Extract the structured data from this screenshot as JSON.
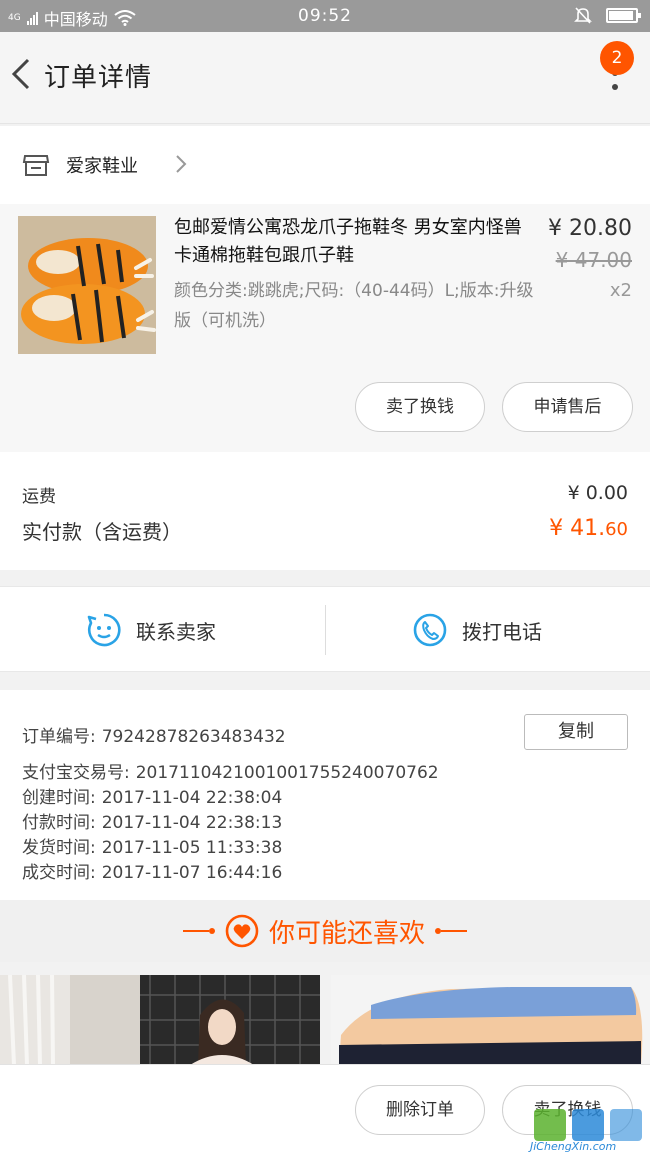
{
  "status_bar": {
    "network": "4G",
    "carrier": "中国移动",
    "time": "09:52"
  },
  "header": {
    "title": "订单详情",
    "badge_count": "2"
  },
  "shop": {
    "name": "爱家鞋业"
  },
  "product": {
    "title": "包邮爱情公寓恐龙爪子拖鞋冬 男女室内怪兽卡通棉拖鞋包跟爪子鞋",
    "spec": "颜色分类:跳跳虎;尺码:（40-44码）L;版本:升级版（可机洗）",
    "price": "¥ 20.80",
    "original_price": "¥ 47.00",
    "quantity": "x2",
    "sell_label": "卖了换钱",
    "after_sale_label": "申请售后"
  },
  "fees": {
    "shipping_label": "运费",
    "shipping_value": "¥ 0.00",
    "paid_label": "实付款（含运费）",
    "paid_value_main": "¥ 41.",
    "paid_value_cents": "60"
  },
  "contact": {
    "chat_label": "联系卖家",
    "call_label": "拨打电话"
  },
  "order_info": {
    "copy_label": "复制",
    "rows": [
      {
        "label": "订单编号:",
        "value": "79242878263483432"
      },
      {
        "label": "支付宝交易号:",
        "value": "2017110421001001755240070762"
      },
      {
        "label": "创建时间:",
        "value": "2017-11-04 22:38:04"
      },
      {
        "label": "付款时间:",
        "value": "2017-11-04 22:38:13"
      },
      {
        "label": "发货时间:",
        "value": "2017-11-05 11:33:38"
      },
      {
        "label": "成交时间:",
        "value": "2017-11-07 16:44:16"
      }
    ]
  },
  "recommend": {
    "title": "你可能还喜欢"
  },
  "bottom_bar": {
    "delete_label": "删除订单",
    "sell_label": "卖了换钱"
  },
  "watermark": {
    "text": "JiChengXin.com"
  },
  "colors": {
    "accent": "#ff5500",
    "status_bar": "#9a9a9a",
    "contact_icon": "#2aa3e6"
  }
}
